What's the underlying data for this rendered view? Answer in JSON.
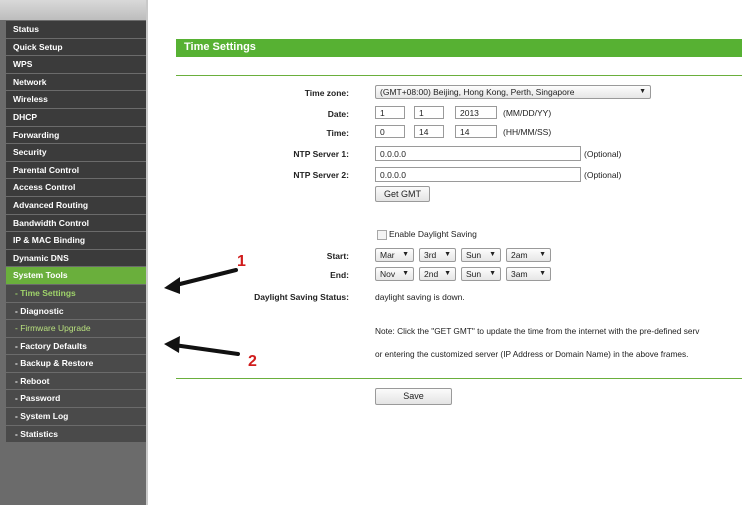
{
  "sidebar": {
    "items": [
      {
        "label": "Status",
        "type": "main"
      },
      {
        "label": "Quick Setup",
        "type": "main"
      },
      {
        "label": "WPS",
        "type": "main"
      },
      {
        "label": "Network",
        "type": "main"
      },
      {
        "label": "Wireless",
        "type": "main"
      },
      {
        "label": "DHCP",
        "type": "main"
      },
      {
        "label": "Forwarding",
        "type": "main"
      },
      {
        "label": "Security",
        "type": "main"
      },
      {
        "label": "Parental Control",
        "type": "main"
      },
      {
        "label": "Access Control",
        "type": "main"
      },
      {
        "label": "Advanced Routing",
        "type": "main"
      },
      {
        "label": "Bandwidth Control",
        "type": "main"
      },
      {
        "label": "IP & MAC Binding",
        "type": "main"
      },
      {
        "label": "Dynamic DNS",
        "type": "main"
      },
      {
        "label": "System Tools",
        "type": "main",
        "state": "active"
      },
      {
        "label": "- Time Settings",
        "type": "sub",
        "state": "active"
      },
      {
        "label": "- Diagnostic",
        "type": "sub"
      },
      {
        "label": "- Firmware Upgrade",
        "type": "sub",
        "state": "highlighted"
      },
      {
        "label": "- Factory Defaults",
        "type": "sub"
      },
      {
        "label": "- Backup & Restore",
        "type": "sub"
      },
      {
        "label": "- Reboot",
        "type": "sub"
      },
      {
        "label": "- Password",
        "type": "sub"
      },
      {
        "label": "- System Log",
        "type": "sub"
      },
      {
        "label": "- Statistics",
        "type": "sub"
      }
    ]
  },
  "page": {
    "title": "Time Settings",
    "accent_color": "#57b133"
  },
  "form": {
    "timezone_label": "Time zone:",
    "timezone_value": "(GMT+08:00) Beijing, Hong Kong, Perth, Singapore",
    "date_label": "Date:",
    "date_month": "1",
    "date_day": "1",
    "date_year": "2013",
    "date_format": "(MM/DD/YY)",
    "time_label": "Time:",
    "time_hour": "0",
    "time_min": "14",
    "time_sec": "14",
    "time_format": "(HH/MM/SS)",
    "ntp1_label": "NTP Server 1:",
    "ntp1_value": "0.0.0.0",
    "ntp2_label": "NTP Server 2:",
    "ntp2_value": "0.0.0.0",
    "optional": "(Optional)",
    "get_gmt_label": "Get GMT",
    "dst_checkbox_label": "Enable Daylight Saving",
    "dst_checked": false,
    "start_label": "Start:",
    "start_month": "Mar",
    "start_week": "3rd",
    "start_day": "Sun",
    "start_hour": "2am",
    "end_label": "End:",
    "end_month": "Nov",
    "end_week": "2nd",
    "end_day": "Sun",
    "end_hour": "3am",
    "dst_status_label": "Daylight Saving Status:",
    "dst_status_value": "daylight saving is down.",
    "note_line1": "Note: Click the \"GET GMT\" to update the time from the internet with the pre-defined serv",
    "note_line2": "or entering the customized server (IP Address or Domain Name) in the above frames.",
    "save_label": "Save"
  },
  "annotations": {
    "arrow1_number": "1",
    "arrow2_number": "2",
    "color": "#d01c1c"
  }
}
